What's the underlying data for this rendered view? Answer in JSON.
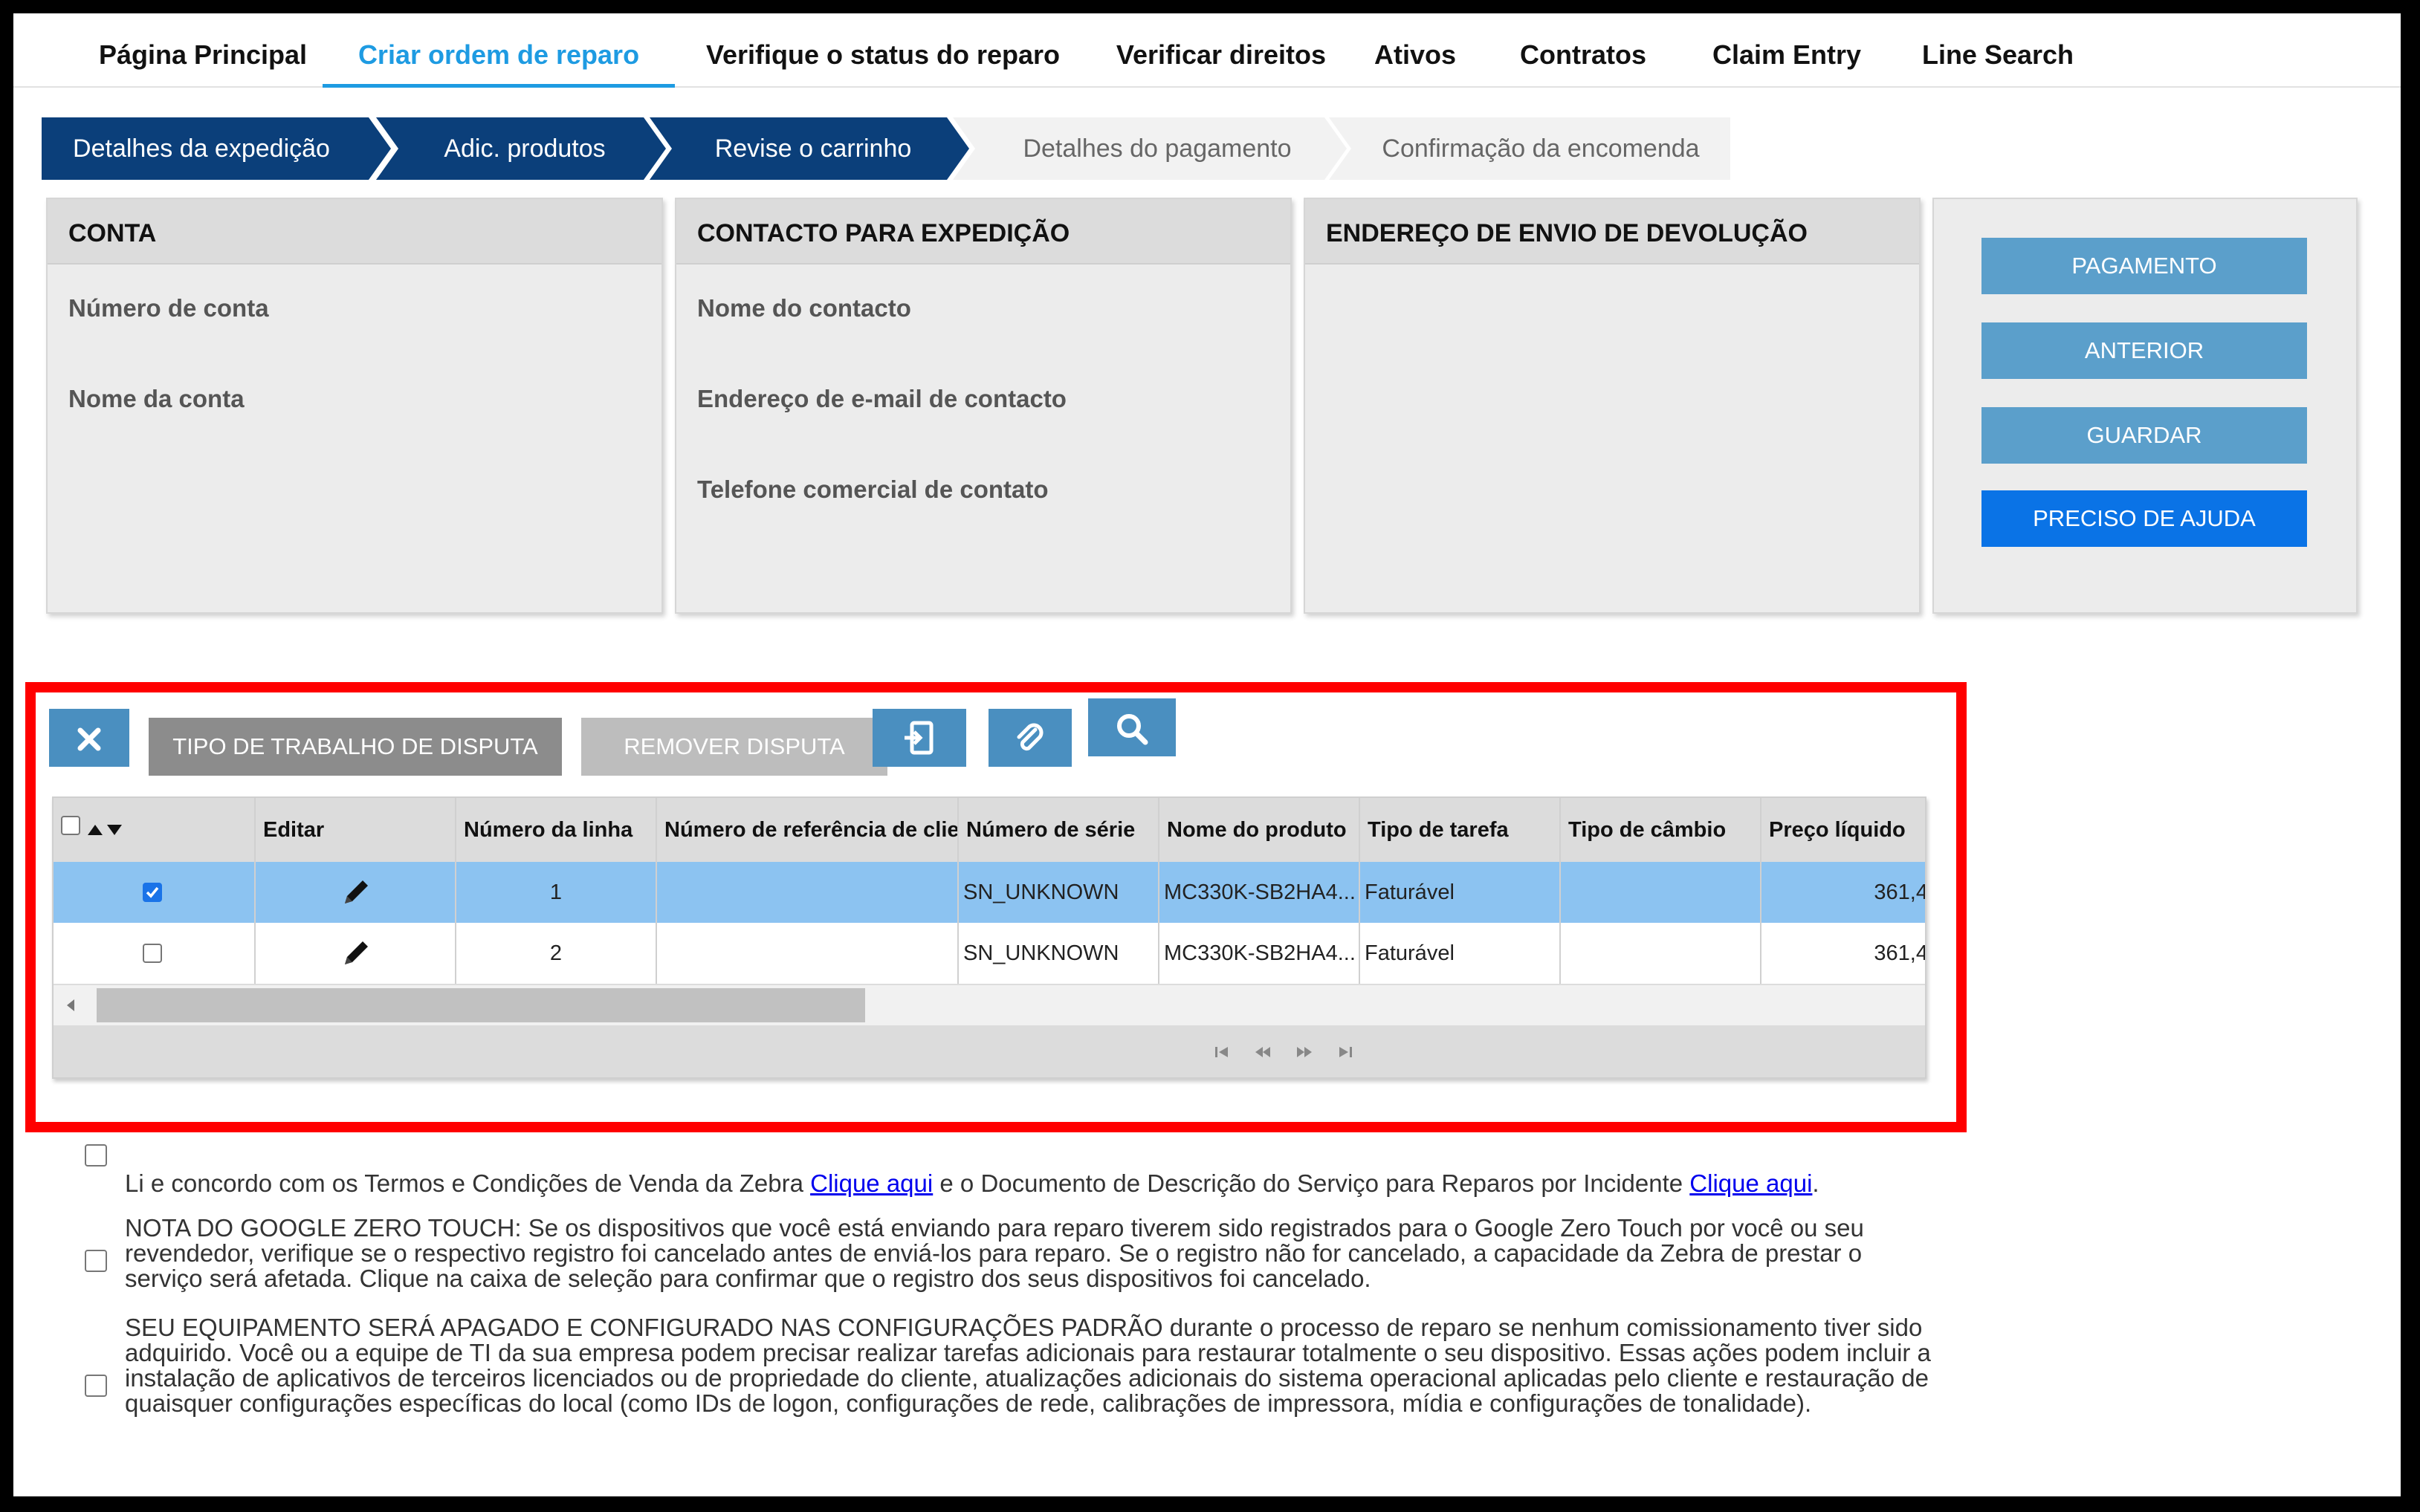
{
  "nav": {
    "items": [
      "Página Principal",
      "Criar ordem de reparo",
      "Verifique o status do reparo",
      "Verificar direitos",
      "Ativos",
      "Contratos",
      "Claim Entry",
      "Line Search"
    ],
    "active": "Criar ordem de reparo"
  },
  "steps": [
    "Detalhes da expedição",
    "Adic. produtos",
    "Revise o carrinho",
    "Detalhes do pagamento",
    "Confirmação da encomenda"
  ],
  "panels": {
    "conta": {
      "title": "CONTA",
      "fields": [
        "Número de conta",
        "Nome da conta"
      ]
    },
    "contacto": {
      "title": "CONTACTO PARA EXPEDIÇÃO",
      "fields": [
        "Nome do contacto",
        "Endereço de e-mail de contacto",
        "Telefone comercial de contato"
      ]
    },
    "endereco": {
      "title": "ENDEREÇO DE ENVIO DE DEVOLUÇÃO"
    }
  },
  "actions": {
    "pagamento": "PAGAMENTO",
    "anterior": "ANTERIOR",
    "guardar": "GUARDAR",
    "ajuda": "PRECISO DE AJUDA"
  },
  "toolbar": {
    "disputa": "TIPO DE TRABALHO DE DISPUTA",
    "remover": "REMOVER DISPUTA"
  },
  "grid": {
    "columns": [
      "Editar",
      "Número da linha",
      "Número de referência de clier",
      "Número de série",
      "Nome do produto",
      "Tipo de tarefa",
      "Tipo de câmbio",
      "Preço líquido"
    ],
    "rows": [
      {
        "checked": true,
        "line": "1",
        "ref": "",
        "serial": "SN_UNKNOWN",
        "product": "MC330K-SB2HA4...",
        "task": "Faturável",
        "exchange": "",
        "price": "361,4"
      },
      {
        "checked": false,
        "line": "2",
        "ref": "",
        "serial": "SN_UNKNOWN",
        "product": "MC330K-SB2HA4...",
        "task": "Faturável",
        "exchange": "",
        "price": "361,4"
      }
    ]
  },
  "legal": {
    "terms_pre": "Li e concordo com os Termos e Condições de Venda da Zebra",
    "link1": "Clique aqui",
    "terms_mid": "e o Documento de Descrição do Serviço para Reparos por Incidente",
    "link2": "Clique aqui",
    "terms_end": ".",
    "google": "NOTA DO GOOGLE ZERO TOUCH: Se os dispositivos que você está enviando para reparo tiverem sido registrados para o Google Zero Touch por você ou seu revendedor, verifique se o respectivo registro foi cancelado antes de enviá-los para reparo. Se o registro não for cancelado, a capacidade da Zebra de prestar o serviço será afetada. Clique na caixa de seleção para confirmar que o registro dos seus dispositivos foi cancelado.",
    "reset": "SEU EQUIPAMENTO SERÁ APAGADO E CONFIGURADO NAS CONFIGURAÇÕES PADRÃO durante o processo de reparo se nenhum comissionamento tiver sido adquirido. Você ou a equipe de TI da sua empresa podem precisar realizar tarefas adicionais para restaurar totalmente o seu dispositivo. Essas ações podem incluir a instalação de aplicativos de terceiros licenciados ou de propriedade do cliente, atualizações adicionais do sistema operacional aplicadas pelo cliente e restauração de quaisquer configurações específicas do local (como IDs de logon, configurações de rede, calibrações de impressora, mídia e configurações de tonalidade)."
  }
}
